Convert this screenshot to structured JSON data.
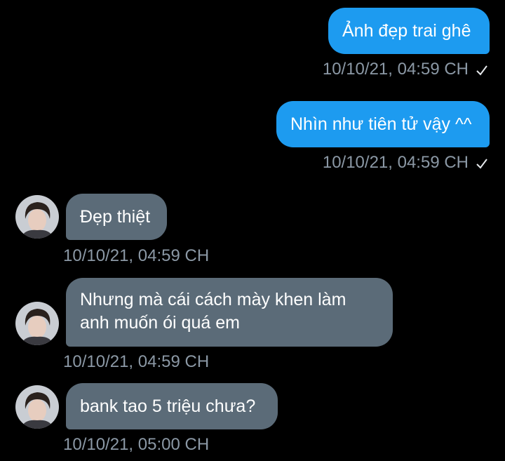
{
  "messages": [
    {
      "direction": "out",
      "text": "Ảnh đẹp trai ghê",
      "timestamp": "10/10/21, 04:59 CH"
    },
    {
      "direction": "out",
      "text": "Nhìn như tiên tử vậy ^^",
      "timestamp": "10/10/21, 04:59 CH"
    },
    {
      "direction": "in",
      "text": "Đẹp thiệt",
      "timestamp": "10/10/21, 04:59 CH"
    },
    {
      "direction": "in",
      "lines": [
        "Nhưng mà cái cách mày khen làm",
        "anh muốn ói quá em"
      ],
      "timestamp": "10/10/21, 04:59 CH"
    },
    {
      "direction": "in",
      "text": "bank tao 5 triệu chưa?",
      "timestamp": "10/10/21, 05:00 CH"
    }
  ],
  "icons": {
    "sent_status": "check-icon",
    "sender_avatar": "avatar"
  },
  "colors": {
    "background": "#000000",
    "outgoing_bubble": "#1d9bf0",
    "incoming_bubble": "#5b6b78",
    "timestamp": "#8b98a5"
  }
}
